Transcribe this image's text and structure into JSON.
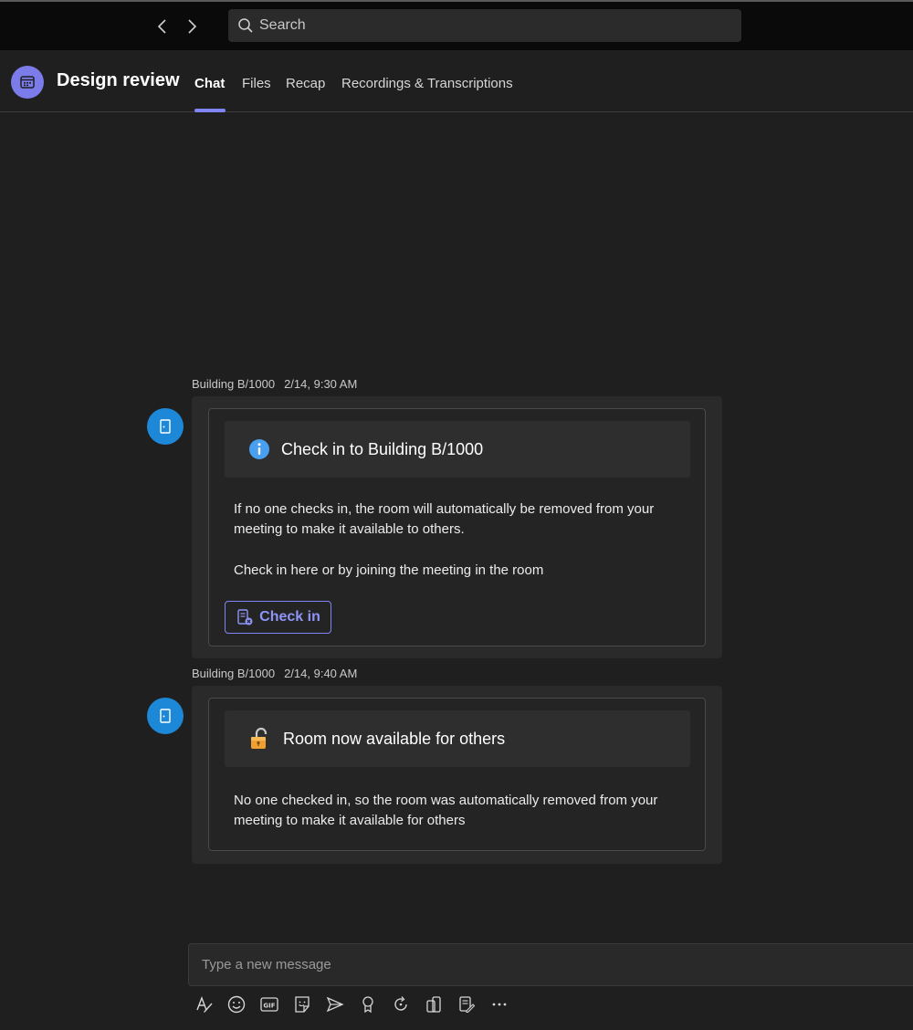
{
  "titlebar": {
    "search_placeholder": "Search"
  },
  "header": {
    "title": "Design review",
    "tabs": [
      {
        "label": "Chat",
        "active": true
      },
      {
        "label": "Files",
        "active": false
      },
      {
        "label": "Recap",
        "active": false
      },
      {
        "label": "Recordings & Transcriptions",
        "active": false
      }
    ]
  },
  "messages": [
    {
      "sender": "Building B/1000",
      "time": "2/14, 9:30 AM",
      "card_title": "Check in to Building B/1000",
      "icon": "info-icon",
      "body_1": "If no one checks in, the room will automatically be removed from your meeting to make it available to others.",
      "body_2": "Check in here or by joining the meeting in the room",
      "button_label": "Check in"
    },
    {
      "sender": "Building B/1000",
      "time": "2/14, 9:40 AM",
      "card_title": "Room now available for others",
      "icon": "unlocked-padlock-icon",
      "body_1": "No one checked in, so the room was automatically removed from your meeting to make it available for others"
    }
  ],
  "compose": {
    "placeholder": "Type a new message"
  },
  "colors": {
    "accent": "#7f85f5",
    "avatar": "#1e88d8",
    "meeting_icon": "#7b7bea",
    "info": "#4aa0f0",
    "padlock": "#f0a030"
  }
}
